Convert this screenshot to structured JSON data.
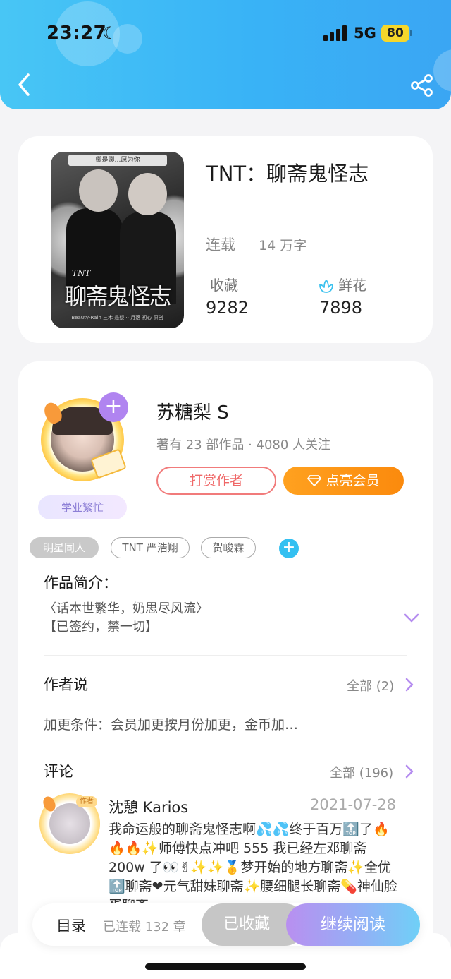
{
  "status_bar": {
    "time": "23:27",
    "network": "5G",
    "battery": "80"
  },
  "book": {
    "title": "TNT：聊斋鬼怪志",
    "status": "连载",
    "word_count": "14 万字",
    "favorites_label": "收藏",
    "favorites_value": "9282",
    "flowers_label": "鲜花",
    "flowers_value": "7898",
    "cover": {
      "banner": "卿是卿…愿为你",
      "tnt": "TNT",
      "title": "聊斋鬼怪志",
      "footer": "Beauty-Rain 三木 悬疑 ·· 月落 初心 原创"
    }
  },
  "author": {
    "name": "苏糖梨 S",
    "meta": "著有 23 部作品 · 4080 人关注",
    "busy_tag": "学业繁忙",
    "tip_button": "打赏作者",
    "vip_button": "点亮会员",
    "tags": [
      "明星同人",
      "TNT 严浩翔",
      "贺峻霖"
    ]
  },
  "intro": {
    "title": "作品简介：",
    "line1": "〈话本世繁华，奶思尽风流〉",
    "line2": "【已签约，禁一切】"
  },
  "author_say": {
    "title": "作者说",
    "all_link": "全部 (2)",
    "text": "加更条件：会员加更按月份加更，金币加…"
  },
  "comments": {
    "title": "评论",
    "all_link": "全部 (196)",
    "first": {
      "badge": "作者",
      "name": "沈憩 Karios",
      "date": "2021-07-28",
      "text": "我命运般的聊斋鬼怪志啊💦💦终于百万🔝了🔥🔥🔥✨师傅快点冲吧 555 我已经左邓聊斋 200w 了👀✌✨✨🥇梦开始的地方聊斋✨全优🔝聊斋❤元气甜妹聊斋✨腰细腿长聊斋💊神仙脸蛋聊斋"
    }
  },
  "bottom_bar": {
    "toc": "目录",
    "chapters": "已连载 132 章",
    "saved": "已收藏",
    "continue": "继续阅读"
  }
}
